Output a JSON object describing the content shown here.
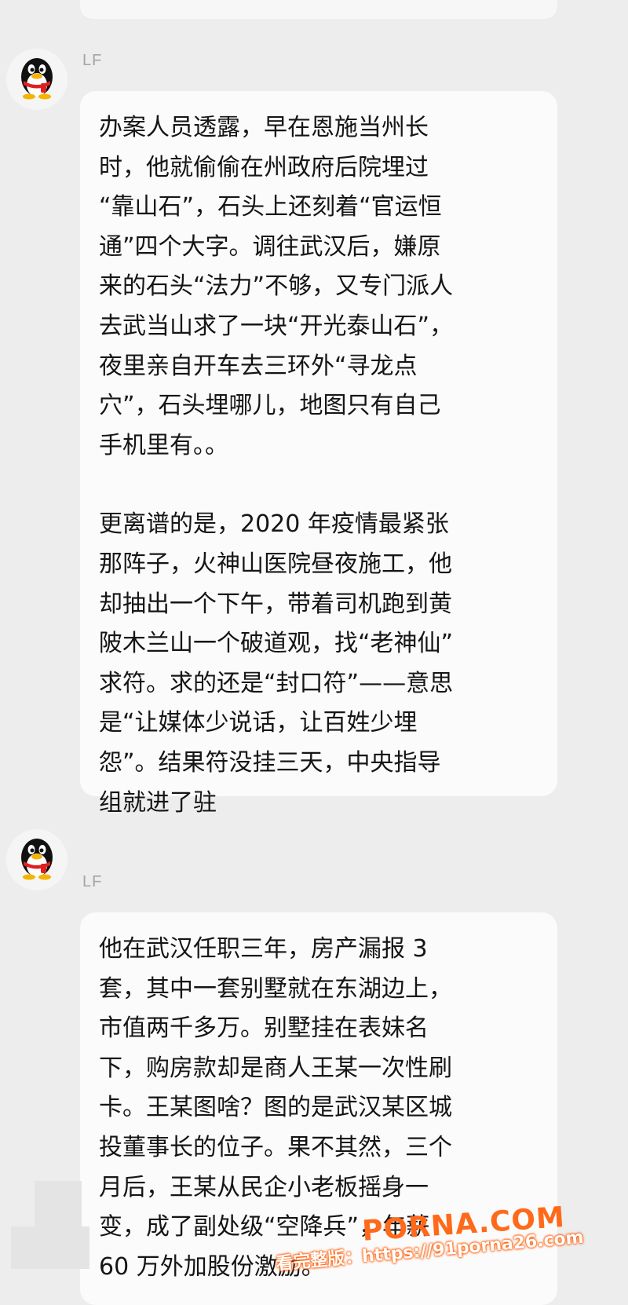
{
  "chat": {
    "messages": [
      {
        "sender": "LF",
        "avatar_icon": "qq-penguin-icon",
        "paragraphs": [
          "办案人员透露，早在恩施当州长\n时，他就偷偷在州政府后院埋过\n“靠山石”，石头上还刻着“官运恒\n通”四个大字。调往武汉后，嫌原\n来的石头“法力”不够，又专门派人\n去武当山求了一块“开光泰山石”，\n夜里亲自开车去三环外“寻龙点\n穴”，石头埋哪儿，地图只有自己\n手机里有。。",
          "更离谱的是，2020 年疫情最紧张\n那阵子，火神山医院昼夜施工，他\n却抽出一个下午，带着司机跑到黄\n陂木兰山一个破道观，找“老神仙”\n求符。求的还是“封口符”——意思\n是“让媒体少说话，让百姓少埋\n怨”。结果符没挂三天，中央指导\n组就进了驻"
        ]
      },
      {
        "sender": "LF",
        "avatar_icon": "qq-penguin-icon",
        "paragraphs": [
          "他在武汉任职三年，房产漏报 3\n套，其中一套别墅就在东湖边上，\n市值两千多万。别墅挂在表妹名\n下，购房款却是商人王某一次性刷\n卡。王某图啥？图的是武汉某区城\n投董事长的位子。果不其然，三个\n月后，王某从民企小老板摇身一\n变，成了副处级“空降兵”，年薪\n60 万外加股份激励。"
        ]
      }
    ]
  },
  "watermark": {
    "brand": "PORNA.COM",
    "url_line": "看完整版：https://91porna26.com"
  },
  "colors": {
    "background": "#ededed",
    "bubble": "#fbfbfb",
    "sender_name": "#a4a4a4",
    "watermark": "#ff6a1a"
  }
}
